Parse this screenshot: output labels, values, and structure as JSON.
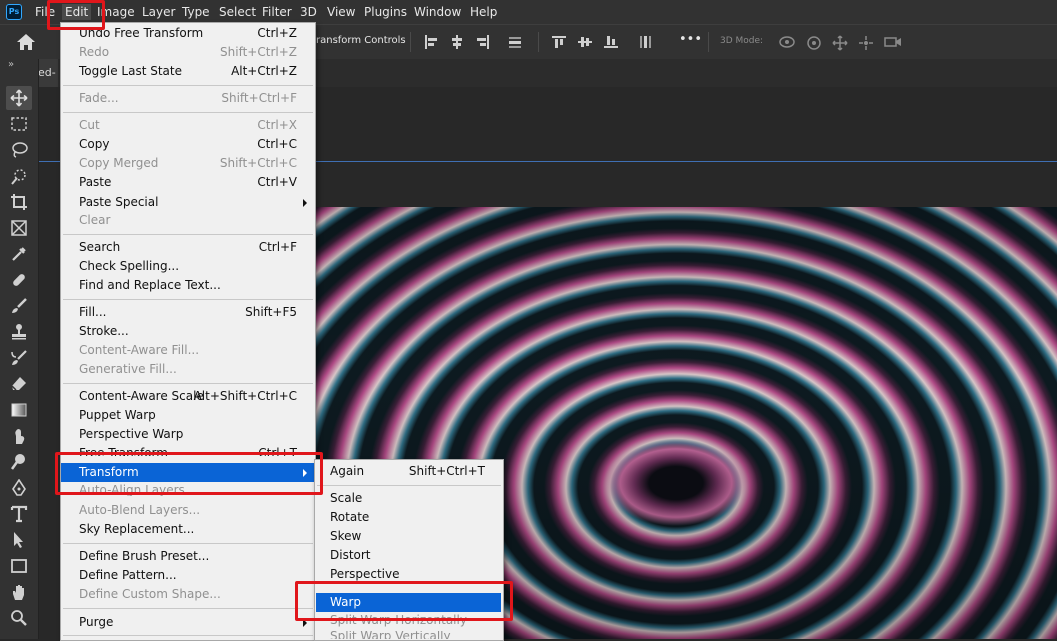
{
  "app": {
    "logo": "Ps",
    "menus": [
      {
        "label": "File",
        "active": false
      },
      {
        "label": "Edit",
        "active": true
      },
      {
        "label": "Image",
        "active": false
      },
      {
        "label": "Layer",
        "active": false
      },
      {
        "label": "Type",
        "active": false
      },
      {
        "label": "Select",
        "active": false
      },
      {
        "label": "Filter",
        "active": false
      },
      {
        "label": "3D",
        "active": false
      },
      {
        "label": "View",
        "active": false
      },
      {
        "label": "Plugins",
        "active": false
      },
      {
        "label": "Window",
        "active": false
      },
      {
        "label": "Help",
        "active": false
      }
    ]
  },
  "options_bar": {
    "transform_controls_label": "ransform Controls",
    "mode_3d_label": "3D Mode:",
    "more_label": "•••"
  },
  "document_tab": {
    "label": "ed-"
  },
  "toolbar": {
    "collapse_label": "»"
  },
  "edit_menu": {
    "items": [
      {
        "label": "Undo Free Transform",
        "shortcut": "Ctrl+Z",
        "disabled": false
      },
      {
        "label": "Redo",
        "shortcut": "Shift+Ctrl+Z",
        "disabled": true
      },
      {
        "label": "Toggle Last State",
        "shortcut": "Alt+Ctrl+Z",
        "disabled": false
      },
      {
        "label": "Fade...",
        "shortcut": "Shift+Ctrl+F",
        "disabled": true
      },
      {
        "label": "Cut",
        "shortcut": "Ctrl+X",
        "disabled": true
      },
      {
        "label": "Copy",
        "shortcut": "Ctrl+C",
        "disabled": false
      },
      {
        "label": "Copy Merged",
        "shortcut": "Shift+Ctrl+C",
        "disabled": true
      },
      {
        "label": "Paste",
        "shortcut": "Ctrl+V",
        "disabled": false
      },
      {
        "label": "Paste Special",
        "shortcut": "",
        "disabled": false,
        "submenu": true
      },
      {
        "label": "Clear",
        "shortcut": "",
        "disabled": true
      },
      {
        "label": "Search",
        "shortcut": "Ctrl+F",
        "disabled": false
      },
      {
        "label": "Check Spelling...",
        "shortcut": "",
        "disabled": false
      },
      {
        "label": "Find and Replace Text...",
        "shortcut": "",
        "disabled": false
      },
      {
        "label": "Fill...",
        "shortcut": "Shift+F5",
        "disabled": false
      },
      {
        "label": "Stroke...",
        "shortcut": "",
        "disabled": false
      },
      {
        "label": "Content-Aware Fill...",
        "shortcut": "",
        "disabled": true
      },
      {
        "label": "Generative Fill...",
        "shortcut": "",
        "disabled": true
      },
      {
        "label": "Content-Aware Scale",
        "shortcut": "Alt+Shift+Ctrl+C",
        "disabled": false
      },
      {
        "label": "Puppet Warp",
        "shortcut": "",
        "disabled": false
      },
      {
        "label": "Perspective Warp",
        "shortcut": "",
        "disabled": false
      },
      {
        "label": "Free Transform",
        "shortcut": "Ctrl+T",
        "disabled": false
      },
      {
        "label": "Transform",
        "shortcut": "",
        "disabled": false,
        "submenu": true,
        "highlighted": true
      },
      {
        "label": "Auto-Align Layers...",
        "shortcut": "",
        "disabled": true
      },
      {
        "label": "Auto-Blend Layers...",
        "shortcut": "",
        "disabled": true
      },
      {
        "label": "Sky Replacement...",
        "shortcut": "",
        "disabled": false
      },
      {
        "label": "Define Brush Preset...",
        "shortcut": "",
        "disabled": false
      },
      {
        "label": "Define Pattern...",
        "shortcut": "",
        "disabled": false
      },
      {
        "label": "Define Custom Shape...",
        "shortcut": "",
        "disabled": true
      },
      {
        "label": "Purge",
        "shortcut": "",
        "disabled": false,
        "submenu": true
      }
    ]
  },
  "transform_submenu": {
    "items": [
      {
        "label": "Again",
        "shortcut": "Shift+Ctrl+T",
        "disabled": false
      },
      {
        "label": "Scale",
        "shortcut": "",
        "disabled": false
      },
      {
        "label": "Rotate",
        "shortcut": "",
        "disabled": false
      },
      {
        "label": "Skew",
        "shortcut": "",
        "disabled": false
      },
      {
        "label": "Distort",
        "shortcut": "",
        "disabled": false
      },
      {
        "label": "Perspective",
        "shortcut": "",
        "disabled": false
      },
      {
        "label": "Warp",
        "shortcut": "",
        "disabled": false,
        "highlighted": true
      },
      {
        "label": "Split Warp Horizontally",
        "shortcut": "",
        "disabled": true
      },
      {
        "label": "Split Warp Vertically",
        "shortcut": "",
        "disabled": true
      }
    ]
  },
  "colors": {
    "highlight": "#0a64d6",
    "annotation": "#e0161b",
    "menu_background": "#f0f0f0",
    "chrome": "#323232"
  }
}
